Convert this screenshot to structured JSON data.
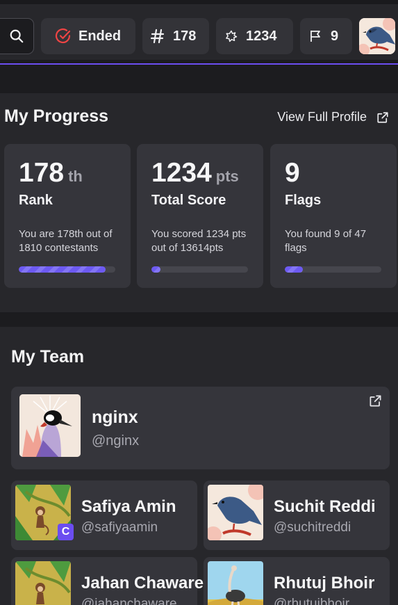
{
  "header": {
    "status_label": "Ended",
    "rank_value": "178",
    "score_value": "1234",
    "flags_value": "9",
    "icons": [
      "search-icon",
      "check-circle-icon",
      "hash-icon",
      "star-burst-icon",
      "flag-icon"
    ],
    "accent_color": "#6b4df0"
  },
  "progress": {
    "title": "My Progress",
    "view_profile_label": "View Full Profile",
    "cards": [
      {
        "number": "178",
        "unit": "th",
        "label": "Rank",
        "desc": "You are 178th out of 1810 contestants",
        "fill": 0.9
      },
      {
        "number": "1234",
        "unit": "pts",
        "label": "Total Score",
        "desc": "You scored 1234 pts out of 13614pts",
        "fill": 0.09
      },
      {
        "number": "9",
        "unit": "",
        "label": "Flags",
        "desc": "You found 9 of 47 flags",
        "fill": 0.19
      }
    ]
  },
  "team": {
    "title": "My Team",
    "name": "nginx",
    "handle": "@nginx",
    "members": [
      {
        "name": "Safiya Amin",
        "handle": "@safiyaamin",
        "badge": "C"
      },
      {
        "name": "Suchit Reddi",
        "handle": "@suchitreddi"
      },
      {
        "name": "Jahan Chaware",
        "handle": "@jahanchaware"
      },
      {
        "name": "Rhutuj Bhoir",
        "handle": "@rhutujbhoir"
      }
    ]
  }
}
